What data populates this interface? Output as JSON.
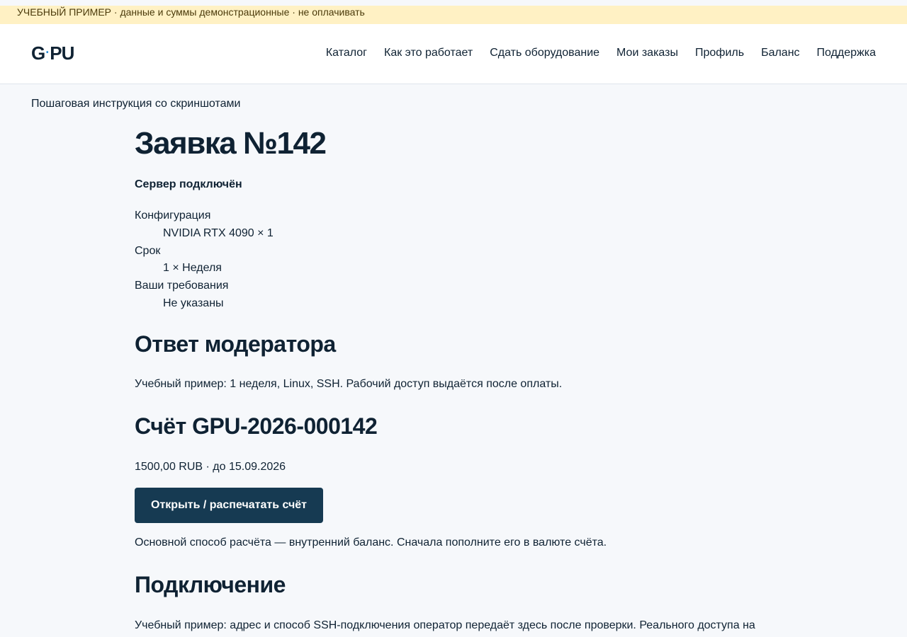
{
  "notice": "УЧЕБНЫЙ ПРИМЕР · данные и суммы демонстрационные · не оплачивать",
  "header": {
    "logo_left": "G",
    "logo_dot": "·",
    "logo_right": "PU",
    "nav": [
      "Каталог",
      "Как это работает",
      "Сдать оборудование",
      "Мои заказы",
      "Профиль",
      "Баланс",
      "Поддержка"
    ]
  },
  "breadcrumb": "Пошаговая инструкция со скриншотами",
  "request": {
    "title": "Заявка №142",
    "status": "Сервер подключён",
    "details": [
      {
        "term": "Конфигурация",
        "value": "NVIDIA RTX 4090 × 1"
      },
      {
        "term": "Срок",
        "value": "1 × Неделя"
      },
      {
        "term": "Ваши требования",
        "value": "Не указаны"
      }
    ]
  },
  "moderator": {
    "heading": "Ответ модератора",
    "text": "Учебный пример: 1 неделя, Linux, SSH. Рабочий доступ выдаётся после оплаты."
  },
  "invoice": {
    "heading": "Счёт GPU-2026-000142",
    "amount_line": "1500,00 RUB · до 15.09.2026",
    "button_label": "Открыть / распечатать счёт",
    "note": "Основной способ расчёта — внутренний баланс. Сначала пополните его в валюте счёта."
  },
  "connection": {
    "heading": "Подключение",
    "text": "Учебный пример: адрес и способ SSH-подключения оператор передаёт здесь после проверки. Реального доступа на"
  }
}
